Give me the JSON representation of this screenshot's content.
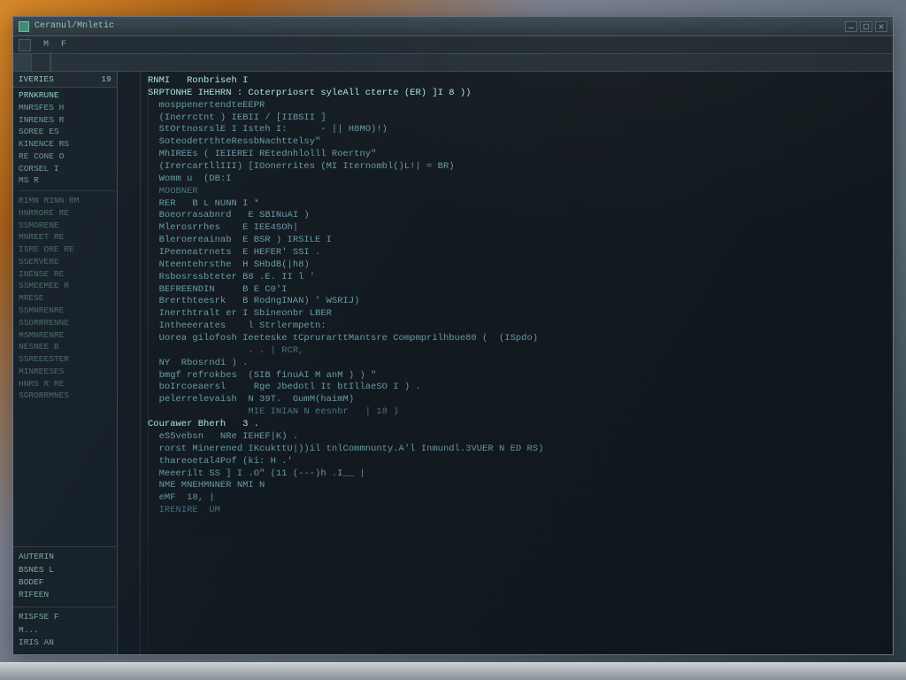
{
  "window": {
    "title": "Ceranul/Mnletic"
  },
  "menubar": {
    "items": [
      "M",
      "F"
    ]
  },
  "tabs": {
    "items": [
      "",
      ""
    ]
  },
  "sidebar": {
    "header_label": "IVERIES",
    "header_value": "19",
    "items_top": [
      "PRNKRUNE",
      "MNRSFES H",
      "INRENES R",
      "SOREE  ES",
      "KINENCE RS",
      "RE CONE O",
      "CORSEL I",
      "MS R"
    ],
    "items_mid": [
      "RIMN RINN RM",
      "HNRRORE RE",
      "SSMORENE",
      "MNREET RE",
      "ISRE ORE RE",
      "SSERVERE",
      "INENSE  RE",
      "SSMEEMEE R",
      "MRESE  ",
      "SSMNRENRE",
      "SSORRRENNE",
      "MSMNRENRE",
      "NESNEE B",
      "SSREEESTER",
      "MINREESES",
      "HNRS R RE",
      "SGRORRMNES"
    ],
    "section2_items": [
      "AUTERIN",
      "BSNES L",
      "BODEF",
      "RIFEEN"
    ],
    "footer_items": [
      "RISFSE F",
      "M...",
      "IRIS AN"
    ]
  },
  "code": {
    "lines": [
      {
        "cls": "k",
        "t": "RNMI   Ronbriseh I"
      },
      {
        "cls": "k",
        "t": "SRPTONHE IHEHRN : Coterpriosrt syleAll cterte (ER) ]I 8 ))"
      },
      {
        "cls": "s",
        "t": "  mosppenertendteEEPR"
      },
      {
        "cls": "s",
        "t": "  (Inerrctnt ) IEBII / [IIBSII ]"
      },
      {
        "cls": "s",
        "t": "  StOrtnosrslE I Isteh I:      - || H8MO)!)"
      },
      {
        "cls": "s",
        "t": "  SoteodetrthteRessbNachttelsy\""
      },
      {
        "cls": "s",
        "t": "  MhIREEs ( IEIEREI REtednhlolll Roertny\""
      },
      {
        "cls": "s",
        "t": "  (IrercartllIII) [IOonerrites (MI Iternombl()L!| = BR)"
      },
      {
        "cls": "s",
        "t": "  Womm u  (DB:I"
      },
      {
        "cls": "d",
        "t": "  MOOBNER"
      },
      {
        "cls": "s",
        "t": "  RER   B L NUNN I *"
      },
      {
        "cls": "s",
        "t": "  Boeorrasabnrd   E SBINuAI )"
      },
      {
        "cls": "s",
        "t": "  Mlerosrrhes    E IEE4SOh|"
      },
      {
        "cls": "s",
        "t": "  Bleroereainab  E BSR ) IRSILE I"
      },
      {
        "cls": "s",
        "t": "  IPeeneatrnets  E HEFER' SSI ."
      },
      {
        "cls": "s",
        "t": "  Nteentehrsthe  H SHbdB(|h8)"
      },
      {
        "cls": "s",
        "t": "  Rsbosrssbteter B8 .E. II l '"
      },
      {
        "cls": "s",
        "t": "  BEFREENDIN     B E C0'I"
      },
      {
        "cls": "s",
        "t": "  Brerthteesrk   B RodngINAN) ' WSRIJ)"
      },
      {
        "cls": "s",
        "t": "  Inerthtralt er I Sbineonbr LBER"
      },
      {
        "cls": "s",
        "t": "  Intheeerates    l Strlermpetn:"
      },
      {
        "cls": "s",
        "t": "  Uorea gilofosh Ieeteske tCprurarttMantsre Compmprilhbue80 (  (ISpdo)"
      },
      {
        "cls": "d",
        "t": "                  . . | RCR,"
      },
      {
        "cls": "s",
        "t": "  NY  Rbosrndi ) ."
      },
      {
        "cls": "s",
        "t": "  bmgf refrokbes  (SIB finuAI M anM ) ) \""
      },
      {
        "cls": "s",
        "t": "  boIrcoeaersl     Rge Jbedotl It btIllaeSO I ) ."
      },
      {
        "cls": "s",
        "t": "  pelerrelevaish  N 39T.  GumM(haimM)"
      },
      {
        "cls": "d",
        "t": "                  MIE INIAN N eesnbr   | 18 )"
      },
      {
        "cls": "d",
        "t": ""
      },
      {
        "cls": "k",
        "t": "Courawer Bherh   3 ."
      },
      {
        "cls": "s",
        "t": "  eS5vebsn   NRe IEHEF|K) ."
      },
      {
        "cls": "s",
        "t": "  rorst Minerened IKcukttU|))il tnlCommnunty.A'l Inmundl.3VUER N ED RS)"
      },
      {
        "cls": "s",
        "t": "  thareoetal4Pof (ki: H .'"
      },
      {
        "cls": "s",
        "t": "  Meeerilt SS ] I .O\" (11 (---)h .I__ |"
      },
      {
        "cls": "s",
        "t": "  NME MNEHMNNER NMI N"
      },
      {
        "cls": "d",
        "t": ""
      },
      {
        "cls": "s",
        "t": "  eMF  18, |"
      },
      {
        "cls": "d",
        "t": "  IRENIRE  UM"
      }
    ]
  }
}
